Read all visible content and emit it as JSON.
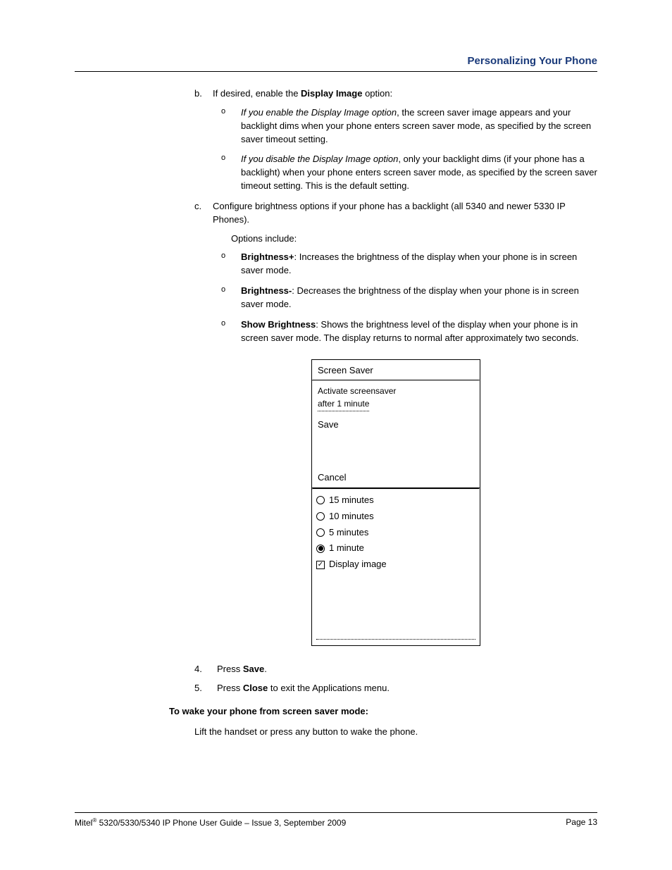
{
  "header": {
    "title": "Personalizing Your Phone"
  },
  "body": {
    "b_marker": "b.",
    "b_text_pre": "If desired, enable the ",
    "b_text_bold": "Display Image",
    "b_text_post": " option:",
    "b_sub": [
      {
        "marker": "o",
        "lead": "If you enable the Display Image option",
        "rest": ", the screen saver image appears and your backlight dims when your phone enters screen saver mode, as specified by the screen saver timeout setting."
      },
      {
        "marker": "o",
        "lead": "If you disable the Display Image option",
        "rest": ", only your backlight dims (if your phone has a backlight) when your phone enters screen saver mode, as specified by the screen saver timeout setting. This is the default setting."
      }
    ],
    "c_marker": "c.",
    "c_text": "Configure brightness options if your phone has a backlight (all 5340 and newer 5330 IP Phones).",
    "c_options_label": "Options include:",
    "c_sub": [
      {
        "marker": "o",
        "lead": "Brightness+",
        "rest": ": Increases the brightness of the display when your phone is in screen saver mode."
      },
      {
        "marker": "o",
        "lead": "Brightness-",
        "rest": ": Decreases the brightness of the display when your phone is in screen saver mode."
      },
      {
        "marker": "o",
        "lead": "Show Brightness",
        "rest": ": Shows the brightness level of the display when your phone is in screen saver mode. The display returns to normal after approximately two seconds."
      }
    ],
    "step4_marker": "4.",
    "step4_pre": "Press ",
    "step4_bold": "Save",
    "step4_post": ".",
    "step5_marker": "5.",
    "step5_pre": "Press ",
    "step5_bold": "Close",
    "step5_post": " to exit the Applications menu.",
    "wake_heading": "To wake your phone from screen saver mode:",
    "wake_text": "Lift the handset or press any button to wake the phone."
  },
  "phone": {
    "title": "Screen Saver",
    "activate_line1": "Activate screensaver",
    "activate_line2": "after 1 minute",
    "save": "Save",
    "cancel": "Cancel",
    "options": [
      {
        "label": "15 minutes",
        "selected": false
      },
      {
        "label": "10 minutes",
        "selected": false
      },
      {
        "label": "5 minutes",
        "selected": false
      },
      {
        "label": "1 minute",
        "selected": true
      }
    ],
    "checkbox_label": "Display image",
    "checkbox_checked": true
  },
  "footer": {
    "left_pre": "Mitel",
    "left_sup": "®",
    "left_post": " 5320/5330/5340 IP Phone User Guide – Issue 3, September 2009",
    "right": "Page 13"
  }
}
